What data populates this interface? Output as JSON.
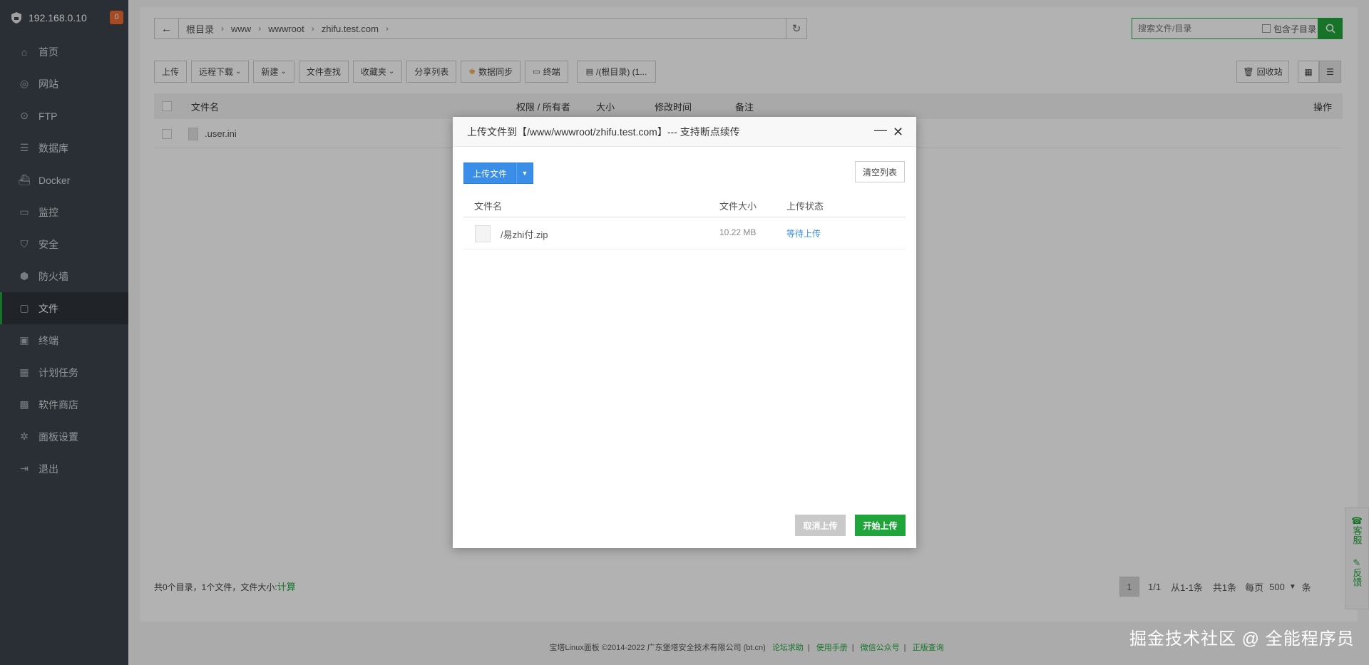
{
  "sidebar": {
    "ip": "192.168.0.10",
    "badge": "0",
    "items": [
      {
        "label": "首页",
        "icon": "home-icon"
      },
      {
        "label": "网站",
        "icon": "globe-icon"
      },
      {
        "label": "FTP",
        "icon": "ftp-icon"
      },
      {
        "label": "数据库",
        "icon": "database-icon"
      },
      {
        "label": "Docker",
        "icon": "docker-icon"
      },
      {
        "label": "监控",
        "icon": "monitor-icon"
      },
      {
        "label": "安全",
        "icon": "shield-icon"
      },
      {
        "label": "防火墙",
        "icon": "firewall-icon"
      },
      {
        "label": "文件",
        "icon": "folder-icon",
        "active": true
      },
      {
        "label": "终端",
        "icon": "terminal-icon"
      },
      {
        "label": "计划任务",
        "icon": "calendar-icon"
      },
      {
        "label": "软件商店",
        "icon": "apps-icon"
      },
      {
        "label": "面板设置",
        "icon": "gear-icon"
      },
      {
        "label": "退出",
        "icon": "logout-icon"
      }
    ]
  },
  "breadcrumb": [
    "根目录",
    "www",
    "wwwroot",
    "zhifu.test.com"
  ],
  "search": {
    "placeholder": "搜索文件/目录",
    "subdir_label": "包含子目录"
  },
  "toolbar": {
    "upload": "上传",
    "remote_download": "远程下载",
    "new": "新建",
    "file_search": "文件查找",
    "favorites": "收藏夹",
    "share_list": "分享列表",
    "data_sync": "数据同步",
    "terminal": "终端",
    "disk": "/(根目录) (1...",
    "recycle": "回收站"
  },
  "table": {
    "headers": {
      "name": "文件名",
      "perm": "权限 / 所有者",
      "size": "大小",
      "mtime": "修改时间",
      "remark": "备注",
      "ops": "操作"
    },
    "rows": [
      {
        "name": ".user.ini"
      }
    ]
  },
  "summary": {
    "text": "共0个目录，1个文件，文件大小:",
    "calc": "计算"
  },
  "pager": {
    "current": "1",
    "pages": "1/1",
    "range": "从1-1条",
    "total": "共1条",
    "per_page_label": "每页",
    "per_page": "500",
    "unit": "条"
  },
  "footer": {
    "copyright": "宝塔Linux面板 ©2014-2022 广东堡塔安全技术有限公司 (bt.cn)",
    "links": [
      "论坛求助",
      "使用手册",
      "微信公众号",
      "正版查询"
    ]
  },
  "side_float": {
    "service": "客服",
    "feedback": "反馈"
  },
  "watermark": "掘金技术社区 @ 全能程序员",
  "modal": {
    "title": "上传文件到【/www/wwwroot/zhifu.test.com】--- 支持断点续传",
    "upload_button": "上传文件",
    "clear_button": "清空列表",
    "headers": {
      "name": "文件名",
      "size": "文件大小",
      "status": "上传状态"
    },
    "files": [
      {
        "name": "/易zhi付.zip",
        "size": "10.22 MB",
        "status": "等待上传"
      }
    ],
    "cancel_button": "取消上传",
    "start_button": "开始上传"
  },
  "colors": {
    "brand": "#20a53a",
    "primary": "#3b8ee8",
    "sidebar": "#3c444d"
  }
}
